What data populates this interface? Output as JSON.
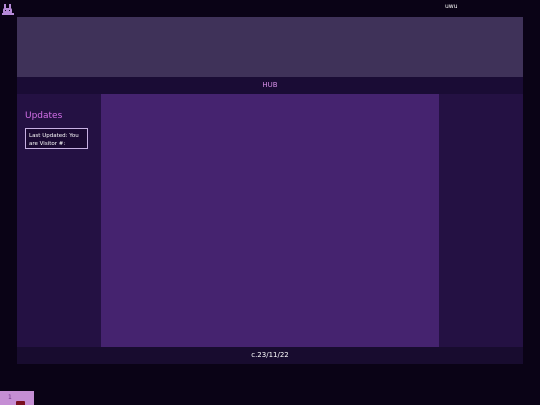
{
  "header": {
    "logo_icon": "bunny-icon",
    "user_text": "uwu"
  },
  "nav": {
    "hub_label": "HUB"
  },
  "sidebar_left": {
    "heading": "Updates",
    "box_text": "Last Updated: You are Visitor #:"
  },
  "footer": {
    "text": "c.23/11/22"
  },
  "chat_widget": {
    "count": "1",
    "icon": "chat-bubble-icon"
  },
  "colors": {
    "page_bg": "#0a0316",
    "banner": "#3f3259",
    "navbar": "#1a0c35",
    "accent_link": "#d58ee6",
    "sidebar": "#241143",
    "main": "#45236f",
    "heading": "#d370e8",
    "chat_widget": "#c58ed4",
    "chat_icon": "#7a0f1f"
  }
}
